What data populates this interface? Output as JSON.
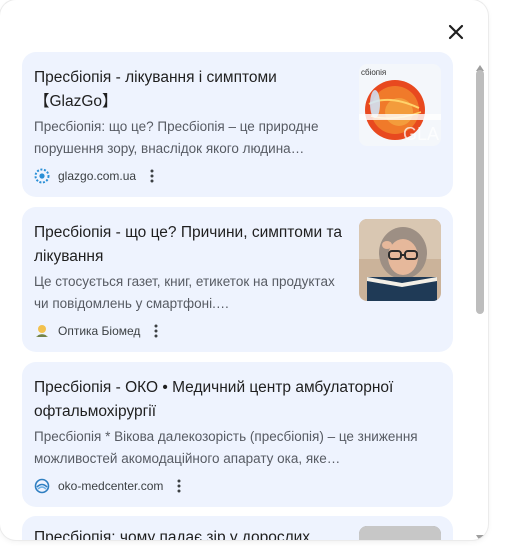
{
  "close_button": {
    "icon": "close-icon"
  },
  "results": [
    {
      "title": "Пресбіопія - лікування і симптоми 【GlazGo】",
      "snippet": "Пресбіопія: що це? Пресбіопія – це природне порушення зору, внаслідок якого людина…",
      "source": "glazgo.com.ua",
      "favicon": "glazgo-logo-icon",
      "thumbnail": {
        "type": "eye-diagram-image",
        "caption": "сбіопія",
        "watermark": "GLA"
      }
    },
    {
      "title": "Пресбіопія - що це? Причини, симптоми та лікування",
      "snippet": "Це стосується газет, книг, етикеток на продуктах чи повідомлень у смартфоні.…",
      "source": "Оптика Біомед",
      "favicon": "biomed-logo-icon",
      "thumbnail": {
        "type": "woman-reading-photo"
      }
    },
    {
      "title": "Пресбіопія - ОКО • Медичний центр амбулаторної офтальмохірургії",
      "snippet": "Пресбіопія * Вікова далекозорість (пресбіопія) – це зниження можливостей акомодаційного апарату ока, яке…",
      "source": "oko-medcenter.com",
      "favicon": "oko-logo-icon"
    },
    {
      "title": "Пресбіопія: чому падає зір у дорослих",
      "thumbnail": {
        "type": "partial-photo"
      }
    }
  ],
  "colors": {
    "card_background": "#eef3fe",
    "title_text": "#1f1f1f",
    "snippet_text": "#575b63",
    "scroll_thumb": "#bdbdbd"
  }
}
